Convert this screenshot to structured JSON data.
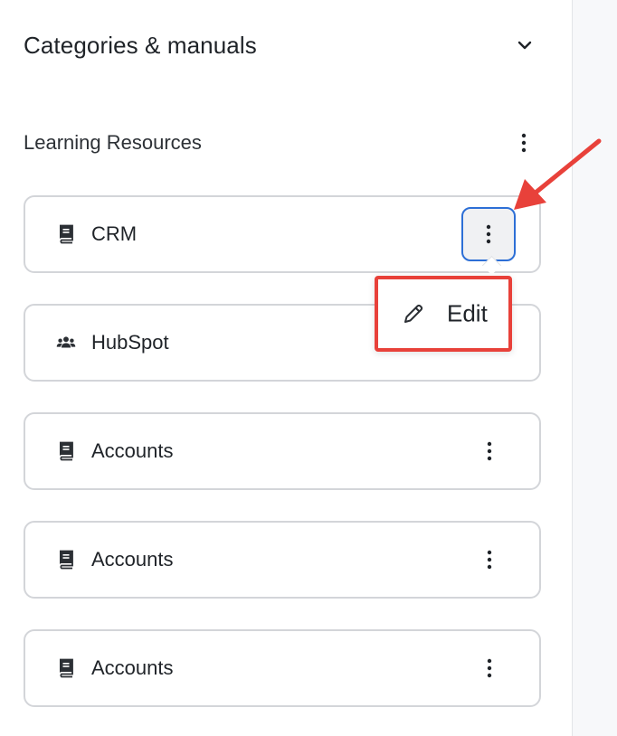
{
  "panel": {
    "title": "Categories & manuals",
    "collapse_icon": "chevron-down-icon"
  },
  "section": {
    "label": "Learning Resources",
    "menu_icon": "kebab-icon"
  },
  "cards": [
    {
      "label": "CRM",
      "icon": "book-icon",
      "has_menu": true,
      "menu_active": true
    },
    {
      "label": "HubSpot",
      "icon": "users-icon",
      "has_menu": false
    },
    {
      "label": "Accounts",
      "icon": "book-icon",
      "has_menu": true
    },
    {
      "label": "Accounts",
      "icon": "book-icon",
      "has_menu": true
    },
    {
      "label": "Accounts",
      "icon": "book-icon",
      "has_menu": true
    }
  ],
  "dropdown": {
    "items": [
      {
        "label": "Edit",
        "icon": "pencil-icon"
      }
    ]
  },
  "colors": {
    "highlight_red": "#e8413a",
    "focus_blue": "#2d6fd6",
    "card_border": "#d3d5d9"
  }
}
